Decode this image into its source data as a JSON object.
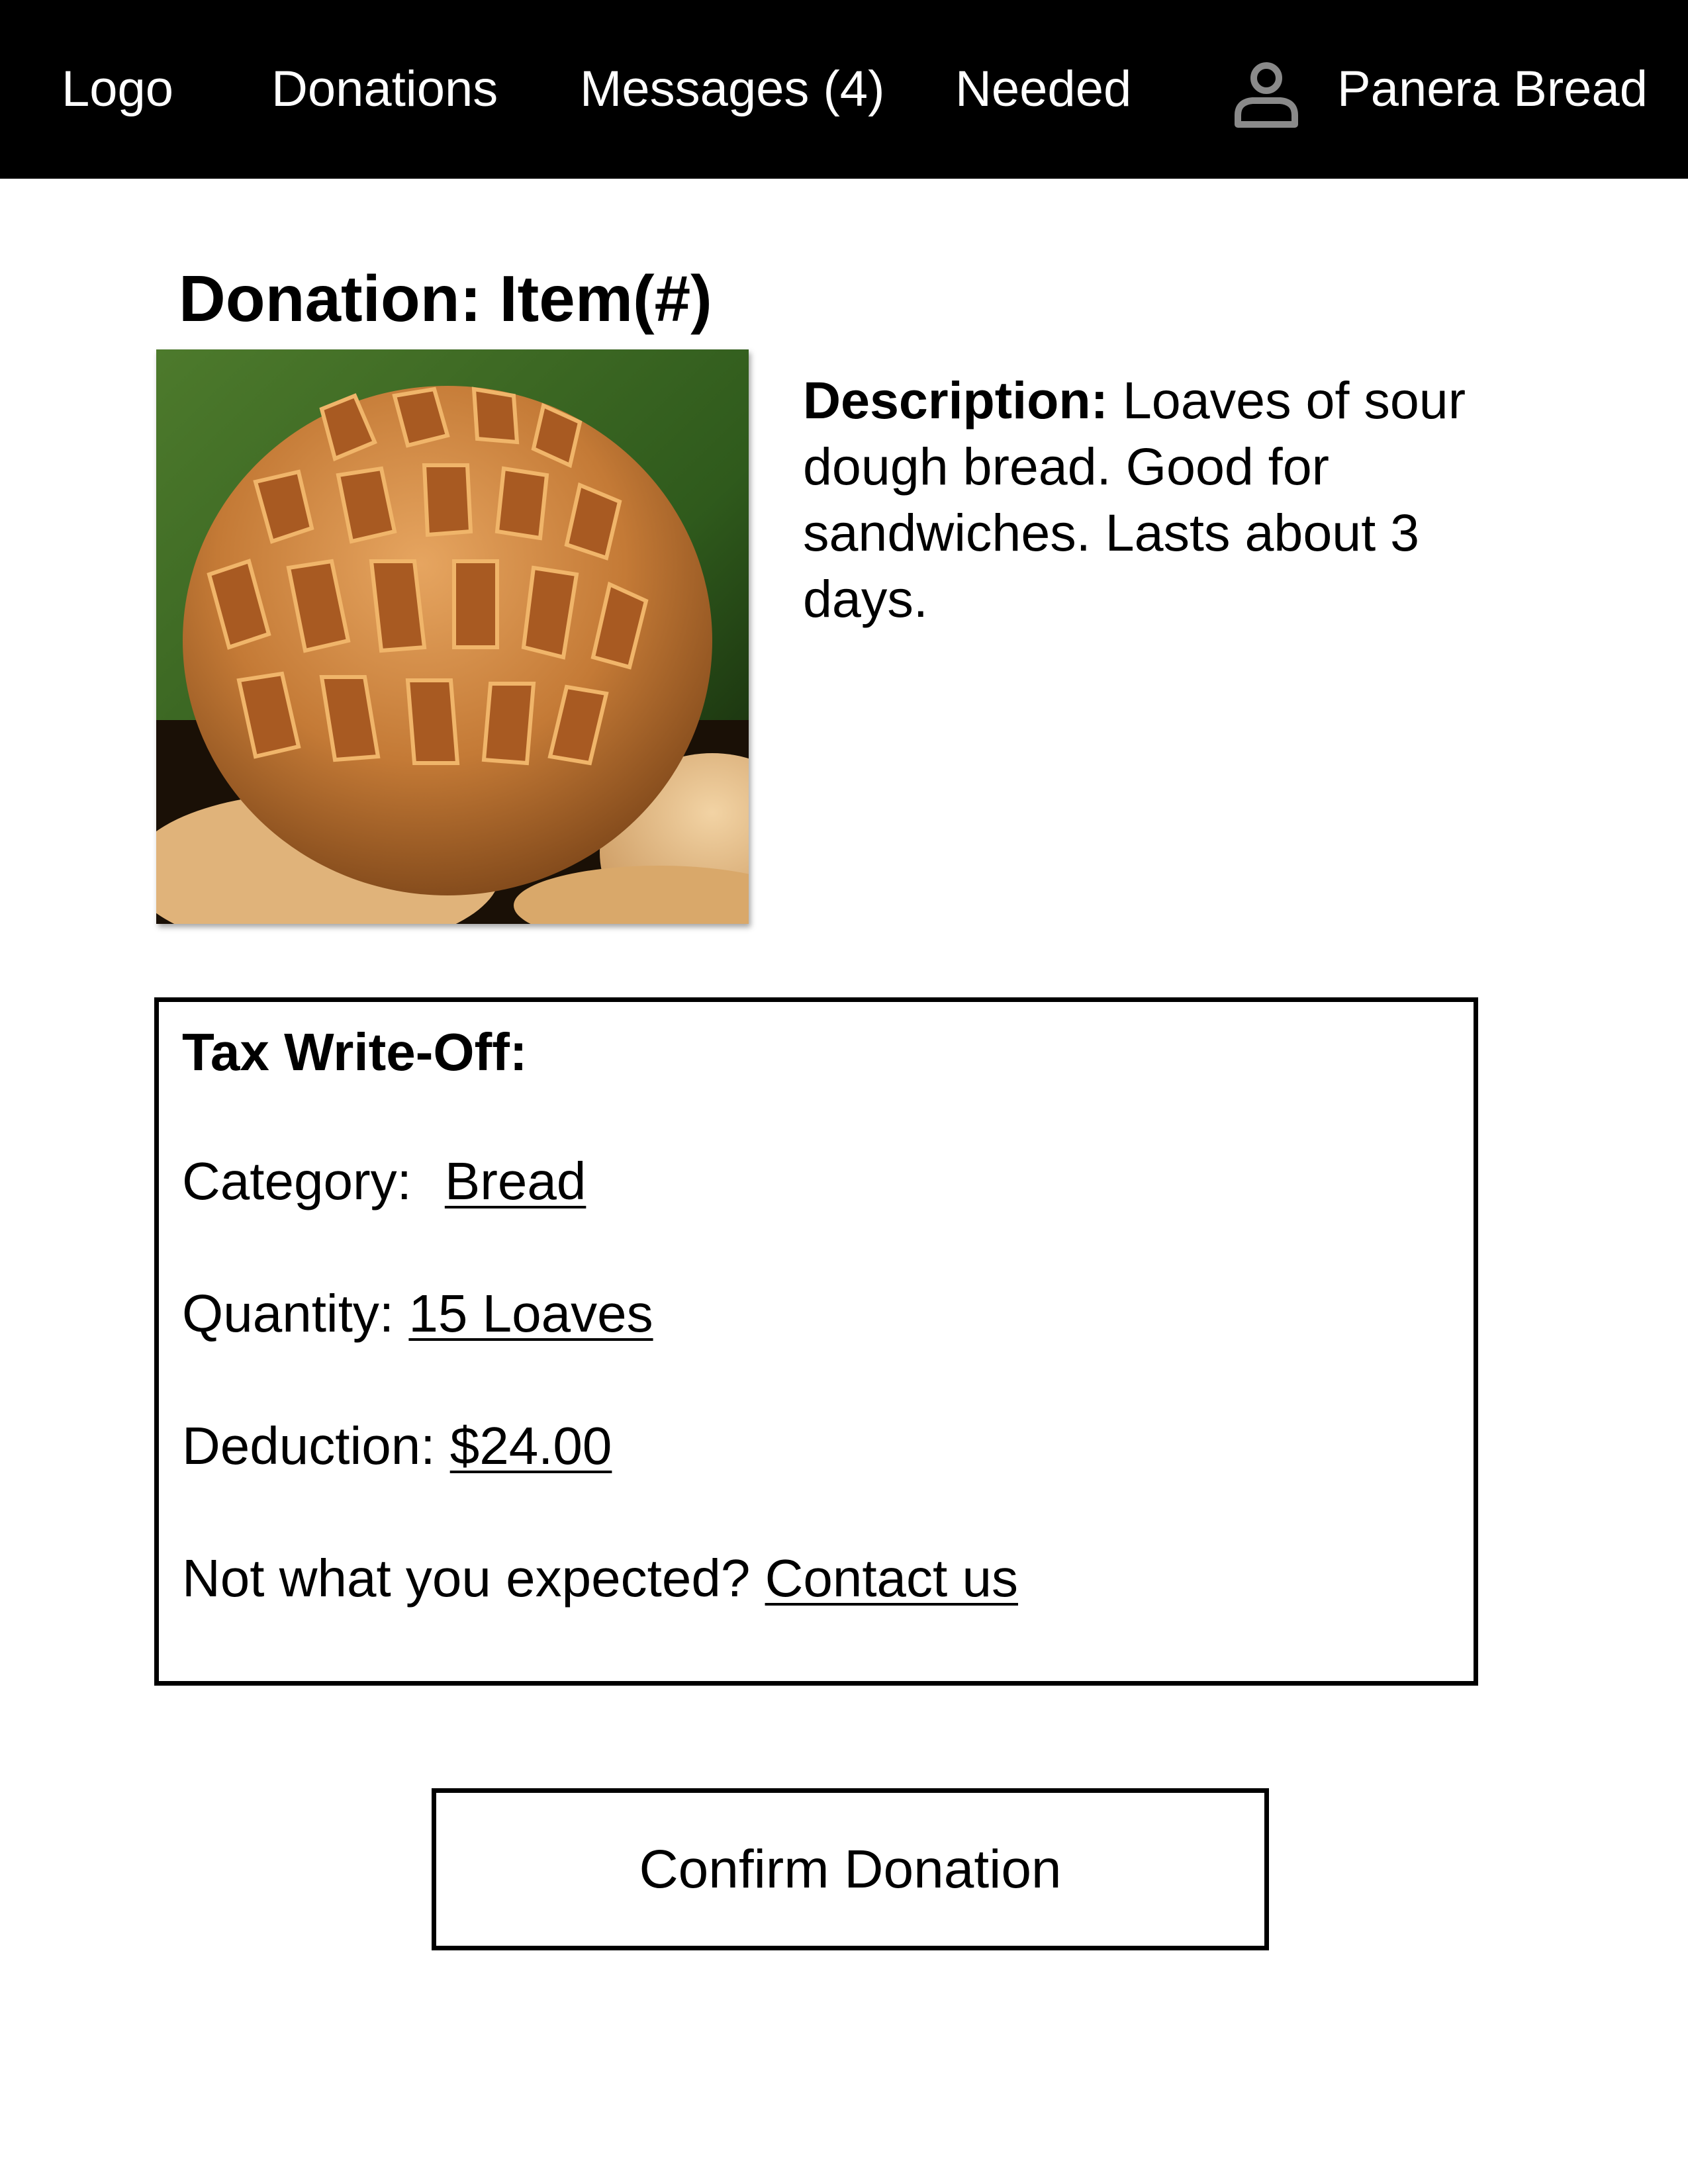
{
  "nav": {
    "logo": "Logo",
    "donations": "Donations",
    "messages": "Messages (4)",
    "needed": "Needed",
    "user_icon": "person-icon",
    "user_name": "Panera Bread"
  },
  "page": {
    "title": "Donation: Item(#)"
  },
  "item": {
    "image": "sourdough-bread-loaf-photo",
    "description_label": "Description:",
    "description_text": "Loaves of sour dough bread. Good for sandwiches. Lasts about 3 days."
  },
  "tax": {
    "title": "Tax Write-Off:",
    "category_label": "Category:",
    "category_value": "Bread",
    "quantity_label": "Quantity:",
    "quantity_value": "15 Loaves",
    "deduction_label": "Deduction:",
    "deduction_value": "$24.00",
    "contact_prompt": "Not what you expected?",
    "contact_link": "Contact us"
  },
  "actions": {
    "confirm_label": "Confirm Donation"
  },
  "colors": {
    "nav_background": "#000000",
    "nav_text": "#ffffff",
    "page_background": "#ffffff",
    "user_icon": "#8a8a8a"
  }
}
